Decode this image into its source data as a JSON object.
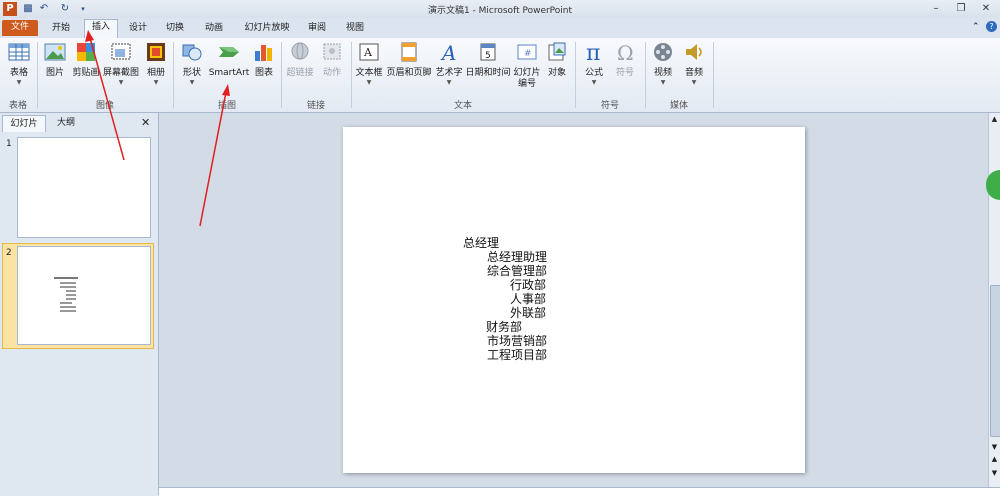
{
  "window": {
    "title": "演示文稿1 - Microsoft PowerPoint"
  },
  "tabs": [
    "文件",
    "开始",
    "插入",
    "设计",
    "切换",
    "动画",
    "幻灯片放映",
    "审阅",
    "视图"
  ],
  "ribbon": {
    "buttons": {
      "table": "表格",
      "picture": "图片",
      "clipart": "剪贴画",
      "screenshot": "屏幕截图",
      "album": "相册",
      "shapes": "形状",
      "smartart": "SmartArt",
      "chart": "图表",
      "hyperlink": "超链接",
      "action": "动作",
      "textbox": "文本框",
      "headerfooter": "页眉和页脚",
      "wordart": "艺术字",
      "datetime": "日期和时间",
      "slidenum_1": "幻灯片",
      "slidenum_2": "编号",
      "object": "对象",
      "equation": "公式",
      "symbol": "符号",
      "video": "视频",
      "audio": "音频"
    },
    "groups": {
      "tables": "表格",
      "images": "图像",
      "illustrations": "插图",
      "links": "链接",
      "text": "文本",
      "symbols": "符号",
      "media": "媒体"
    }
  },
  "leftpane": {
    "tab_slides": "幻灯片",
    "tab_outline": "大纲",
    "slide_numbers": [
      "1",
      "2"
    ]
  },
  "slide": {
    "lines": [
      "总经理",
      "总经理助理",
      "综合管理部",
      "行政部",
      "人事部",
      "外联部",
      "财务部",
      "市场营销部",
      "工程项目部"
    ]
  },
  "colors": {
    "file_tab": "#cf5a1d",
    "annotation_arrow": "#e02020"
  }
}
